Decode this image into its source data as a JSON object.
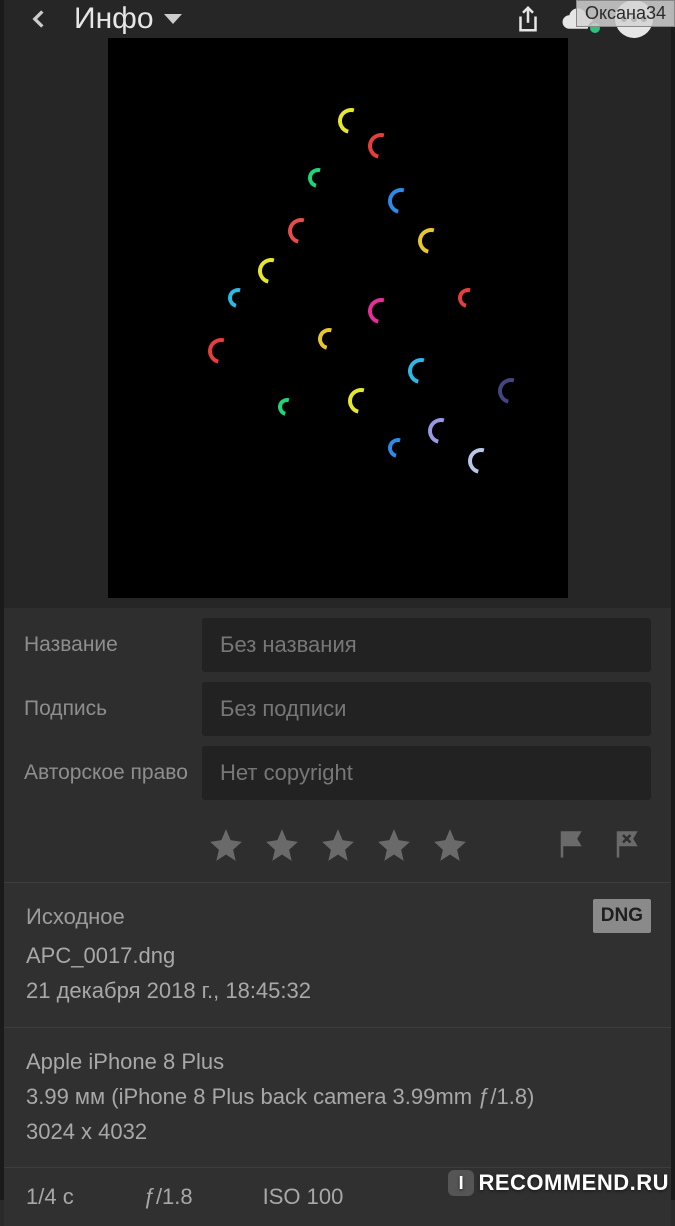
{
  "watermark": {
    "user": "Оксана34",
    "site": "RECOMMEND.RU"
  },
  "header": {
    "title": "Инфо"
  },
  "fields": {
    "title": {
      "label": "Название",
      "placeholder": "Без названия"
    },
    "caption": {
      "label": "Подпись",
      "placeholder": "Без подписи"
    },
    "copyright": {
      "label": "Авторское право",
      "placeholder": "Нет copyright"
    }
  },
  "source": {
    "heading": "Исходное",
    "badge": "DNG",
    "filename": "APC_0017.dng",
    "datetime": "21 декабря 2018 г., 18:45:32"
  },
  "camera": {
    "device": "Apple iPhone 8 Plus",
    "lens": "3.99 мм (iPhone 8 Plus back camera 3.99mm ƒ/1.8)",
    "dimensions": "3024 x 4032"
  },
  "exposure": {
    "shutter": "1/4 с",
    "aperture": "ƒ/1.8",
    "iso": "ISO 100"
  }
}
